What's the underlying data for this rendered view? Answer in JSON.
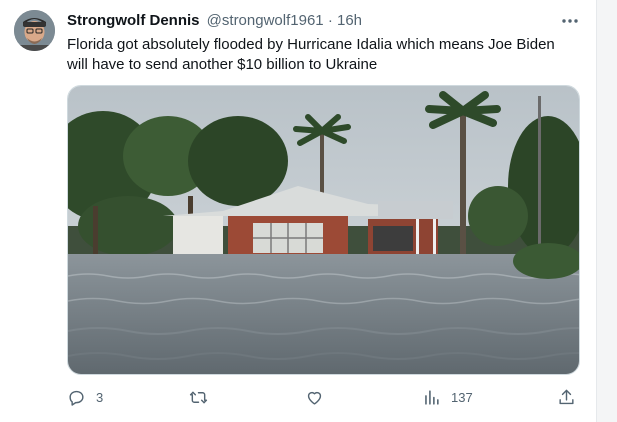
{
  "tweet": {
    "author": {
      "display_name": "Strongwolf Dennis",
      "handle": "@strongwolf1961",
      "separator": "·",
      "time": "16h",
      "avatar_icon": "user-avatar"
    },
    "text": "Florida got absolutely flooded by Hurricane Idalia which means Joe Biden will have to send another $10 billion to Ukraine",
    "media_icon": "flooded-house-photo",
    "more_icon": "more-horizontal-icon",
    "actions": {
      "reply": {
        "icon": "reply-icon",
        "count": "3"
      },
      "retweet": {
        "icon": "retweet-icon",
        "count": ""
      },
      "like": {
        "icon": "heart-icon",
        "count": ""
      },
      "views": {
        "icon": "views-chart-icon",
        "count": "137"
      },
      "share": {
        "icon": "share-icon"
      }
    }
  },
  "colors": {
    "text_primary": "#0f1419",
    "text_secondary": "#536471",
    "border": "#cfd9de",
    "background": "#ffffff"
  }
}
